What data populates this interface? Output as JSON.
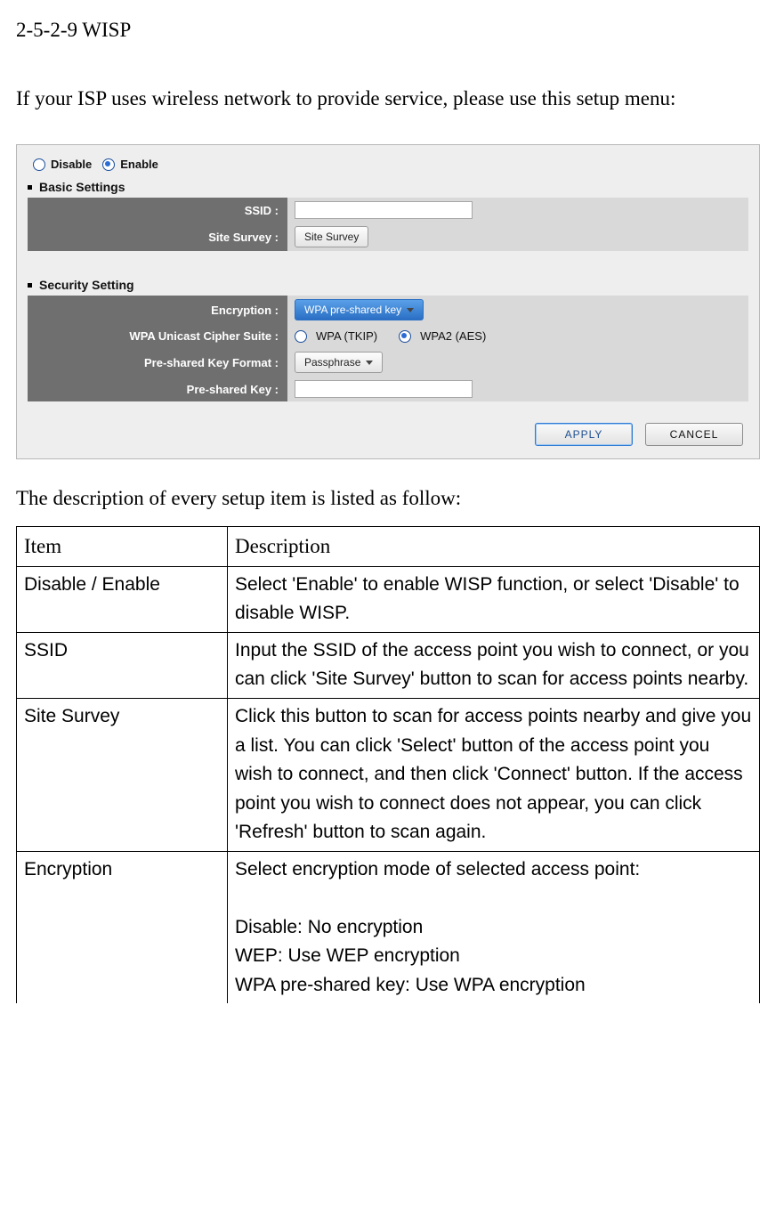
{
  "title": "2-5-2-9 WISP",
  "intro": "If your ISP uses wireless network to provide service, please use this setup menu:",
  "desc_lead": "The description of every setup item is listed as follow:",
  "radio": {
    "disable": "Disable",
    "enable": "Enable"
  },
  "groups": {
    "basic": "Basic Settings",
    "security": "Security Setting"
  },
  "labels": {
    "ssid": "SSID :",
    "site_survey": "Site Survey :",
    "encryption": "Encryption :",
    "cipher": "WPA Unicast Cipher Suite :",
    "psk_format": "Pre-shared Key Format :",
    "psk": "Pre-shared Key :"
  },
  "buttons": {
    "site_survey": "Site Survey",
    "apply": "APPLY",
    "cancel": "CANCEL"
  },
  "selects": {
    "encryption": "WPA pre-shared key",
    "psk_format": "Passphrase"
  },
  "cipher_opts": {
    "tkip": "WPA (TKIP)",
    "aes": "WPA2 (AES)"
  },
  "table": {
    "head": {
      "item": "Item",
      "desc": "Description"
    },
    "rows": [
      {
        "item": "Disable / Enable",
        "desc": "Select 'Enable' to enable WISP function, or select 'Disable' to disable WISP."
      },
      {
        "item": "SSID",
        "desc": "Input the SSID of the access point you wish to connect, or you can click 'Site Survey' button to scan for access points nearby."
      },
      {
        "item": "Site Survey",
        "desc": "Click this button to scan for access points nearby and give you a list. You can click 'Select' button of the access point you wish to connect, and then click 'Connect' button. If the access point you wish to connect does not appear, you can click 'Refresh' button to scan again."
      },
      {
        "item": "Encryption",
        "desc": "Select encryption mode of selected access point:\n\nDisable: No encryption\nWEP: Use WEP encryption\nWPA pre-shared key: Use WPA encryption"
      }
    ]
  }
}
